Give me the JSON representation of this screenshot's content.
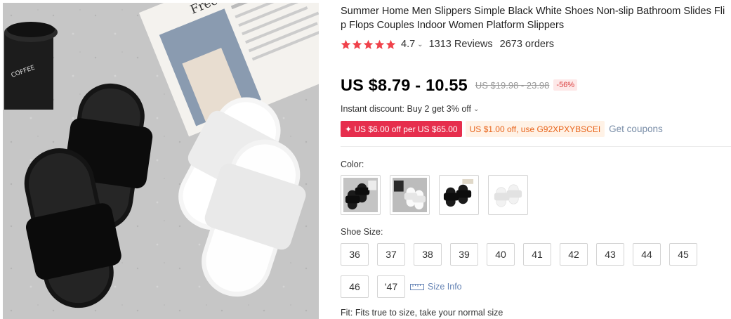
{
  "product": {
    "title": "Summer Home Men Slippers Simple Black White Shoes Non-slip Bathroom Slides Flip Flops Couples Indoor Women Platform Slippers",
    "image_alt": "product-photo",
    "mug_text": "COFFEE",
    "magazine_text": "Free Spirit"
  },
  "rating": {
    "value": "4.7",
    "stars": 5,
    "reviews": "1313 Reviews",
    "orders": "2673 orders"
  },
  "price": {
    "current": "US $8.79 - 10.55",
    "original": "US $19.98 - 23.98",
    "discount": "-56%"
  },
  "instant_discount": "Instant discount: Buy 2 get 3% off",
  "coupons": {
    "store_coupon": "✦ US $6.00 off per US $65.00",
    "code_coupon": "US $1.00 off, use G92XPXYBSCEI",
    "get_coupons": "Get coupons"
  },
  "color": {
    "label": "Color:",
    "options": [
      {
        "name": "black-pair-on-floor"
      },
      {
        "name": "white-pair-on-floor"
      },
      {
        "name": "black-pair-on-white"
      },
      {
        "name": "white-pair-on-white"
      }
    ]
  },
  "shoe_size": {
    "label": "Shoe Size:",
    "row1": [
      "36",
      "37",
      "38",
      "39",
      "40",
      "41",
      "42",
      "43",
      "44",
      "45"
    ],
    "row2": [
      "46",
      "'47"
    ],
    "size_info": "Size Info"
  },
  "fit": "Fit: Fits true to size, take your normal size",
  "colors": {
    "star": "#f0424b",
    "price": "#000000",
    "coupon_red": "#e62e4d",
    "coupon_orange_text": "#e8641b",
    "link": "#6684b5"
  }
}
